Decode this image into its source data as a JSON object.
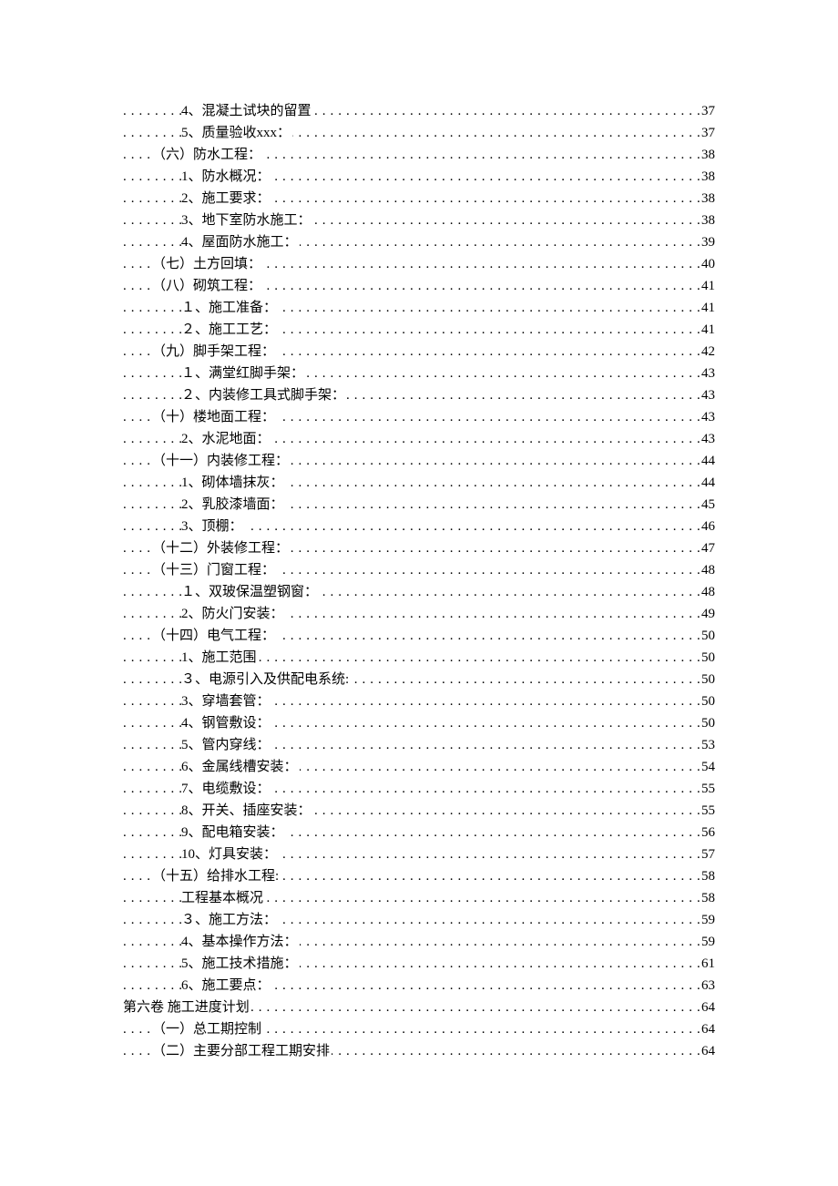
{
  "toc": [
    {
      "label": "4、混凝土试块的留置",
      "page": "37",
      "indent": 2
    },
    {
      "label": "5、质量验收xxx：",
      "page": "37",
      "indent": 2
    },
    {
      "label": "（六）防水工程：",
      "page": "38",
      "indent": 1
    },
    {
      "label": "1、防水概况：",
      "page": "38",
      "indent": 2
    },
    {
      "label": "2、施工要求：",
      "page": "38",
      "indent": 2
    },
    {
      "label": "3、地下室防水施工：",
      "page": "38",
      "indent": 2
    },
    {
      "label": "4、屋面防水施工：",
      "page": "39",
      "indent": 2
    },
    {
      "label": "（七）土方回填：",
      "page": "40",
      "indent": 1
    },
    {
      "label": "（八）砌筑工程：",
      "page": "41",
      "indent": 1
    },
    {
      "label": "１、施工准备：",
      "page": "41",
      "indent": 2
    },
    {
      "label": "２、施工工艺：",
      "page": "41",
      "indent": 2
    },
    {
      "label": "（九）脚手架工程：",
      "page": "42",
      "indent": 1
    },
    {
      "label": "１、满堂红脚手架：",
      "page": "43",
      "indent": 2
    },
    {
      "label": "２、内装修工具式脚手架：",
      "page": "43",
      "indent": 2
    },
    {
      "label": "（十）楼地面工程：",
      "page": "43",
      "indent": 1
    },
    {
      "label": "2、水泥地面：",
      "page": "43",
      "indent": 2
    },
    {
      "label": "（十一）内装修工程：",
      "page": "44",
      "indent": 1
    },
    {
      "label": "1、砌体墙抹灰：",
      "page": "44",
      "indent": 2
    },
    {
      "label": "2、乳胶漆墙面：",
      "page": "45",
      "indent": 2
    },
    {
      "label": "3、顶棚：",
      "page": "46",
      "indent": 2
    },
    {
      "label": "（十二）外装修工程：",
      "page": "47",
      "indent": 1
    },
    {
      "label": "（十三）门窗工程：",
      "page": "48",
      "indent": 1
    },
    {
      "label": "１、双玻保温塑钢窗：",
      "page": "48",
      "indent": 2
    },
    {
      "label": "2、防火门安装：",
      "page": "49",
      "indent": 2
    },
    {
      "label": "（十四）电气工程：",
      "page": "50",
      "indent": 1
    },
    {
      "label": "1、施工范围",
      "page": "50",
      "indent": 2
    },
    {
      "label": "３、电源引入及供配电系统:",
      "page": "50",
      "indent": 2
    },
    {
      "label": "3、穿墙套管：",
      "page": "50",
      "indent": 2
    },
    {
      "label": "4、钢管敷设：",
      "page": " 50",
      "indent": 2
    },
    {
      "label": "5、管内穿线：",
      "page": "53",
      "indent": 2
    },
    {
      "label": "6、金属线槽安装：",
      "page": "54",
      "indent": 2
    },
    {
      "label": "7、电缆敷设：",
      "page": "55",
      "indent": 2
    },
    {
      "label": "8、开关、插座安装：",
      "page": "55",
      "indent": 2
    },
    {
      "label": "9、配电箱安装：",
      "page": "56",
      "indent": 2
    },
    {
      "label": "10、灯具安装：",
      "page": "57",
      "indent": 2
    },
    {
      "label": "（十五）给排水工程:",
      "page": "58",
      "indent": 1
    },
    {
      "label": "工程基本概况",
      "page": "58",
      "indent": 2
    },
    {
      "label": "３、施工方法：",
      "page": "59",
      "indent": 2
    },
    {
      "label": "4、基本操作方法：",
      "page": "59",
      "indent": 2
    },
    {
      "label": "5、施工技术措施：",
      "page": "61",
      "indent": 2
    },
    {
      "label": "6、施工要点：",
      "page": "63",
      "indent": 2
    },
    {
      "label": "第六卷  施工进度计划",
      "page": "64",
      "indent": 0
    },
    {
      "label": "（一）总工期控制",
      "page": "64",
      "indent": 1
    },
    {
      "label": "（二）主要分部工程工期安排",
      "page": "64",
      "indent": 1
    }
  ]
}
